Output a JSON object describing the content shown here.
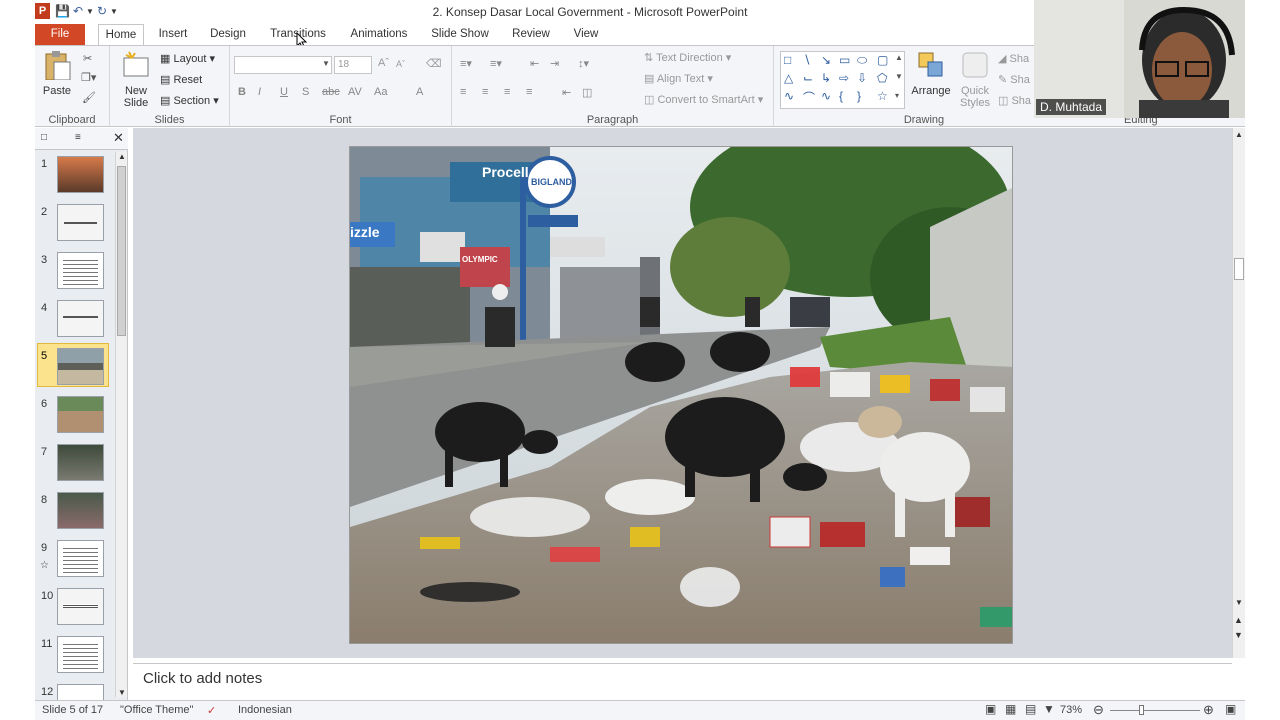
{
  "window": {
    "title": "2. Konsep Dasar Local Government  -  Microsoft PowerPoint",
    "app_icon": "P"
  },
  "tabs": [
    {
      "label": "File",
      "active": false
    },
    {
      "label": "Home",
      "active": true
    },
    {
      "label": "Insert",
      "active": false
    },
    {
      "label": "Design",
      "active": false
    },
    {
      "label": "Transitions",
      "active": false
    },
    {
      "label": "Animations",
      "active": false
    },
    {
      "label": "Slide Show",
      "active": false
    },
    {
      "label": "Review",
      "active": false
    },
    {
      "label": "View",
      "active": false
    }
  ],
  "ribbon": {
    "clipboard": {
      "label": "Clipboard",
      "paste": "Paste"
    },
    "slides": {
      "label": "Slides",
      "new_slide": "New\nSlide",
      "new_slide_line1": "New",
      "new_slide_line2": "Slide",
      "layout": "Layout",
      "reset": "Reset",
      "section": "Section"
    },
    "font": {
      "label": "Font",
      "font_name": "",
      "font_size": "18"
    },
    "paragraph": {
      "label": "Paragraph",
      "text_direction": "Text Direction",
      "align_text": "Align Text",
      "convert_smartart": "Convert to SmartArt"
    },
    "drawing": {
      "label": "Drawing",
      "arrange": "Arrange",
      "quick_styles_line1": "Quick",
      "quick_styles_line2": "Styles",
      "shape_fill": "Sha",
      "shape_outline": "Sha",
      "shape_effects": "Sha"
    },
    "editing": {
      "label": "Editing"
    }
  },
  "slides_panel": {
    "thumbnails": [
      {
        "num": "1",
        "selected": false
      },
      {
        "num": "2",
        "selected": false
      },
      {
        "num": "3",
        "selected": false
      },
      {
        "num": "4",
        "selected": false
      },
      {
        "num": "5",
        "selected": true
      },
      {
        "num": "6",
        "selected": false
      },
      {
        "num": "7",
        "selected": false
      },
      {
        "num": "8",
        "selected": false
      },
      {
        "num": "9",
        "selected": false
      },
      {
        "num": "10",
        "selected": false
      },
      {
        "num": "11",
        "selected": false
      },
      {
        "num": "12",
        "selected": false
      }
    ]
  },
  "slide_image": {
    "sign_text": "Procell",
    "logo_text": "BIGLAND",
    "store_text": "OLYMPIC",
    "sign2_text": "izzle"
  },
  "notes": {
    "placeholder": "Click to add notes"
  },
  "status": {
    "slide_counter": "Slide 5 of 17",
    "theme": "\"Office Theme\"",
    "language": "Indonesian",
    "zoom": "73%"
  },
  "webcam": {
    "name": "D. Muhtada"
  },
  "colors": {
    "file_tab": "#d24726",
    "accent": "#2e5d9f",
    "selection": "#fbe38e"
  }
}
